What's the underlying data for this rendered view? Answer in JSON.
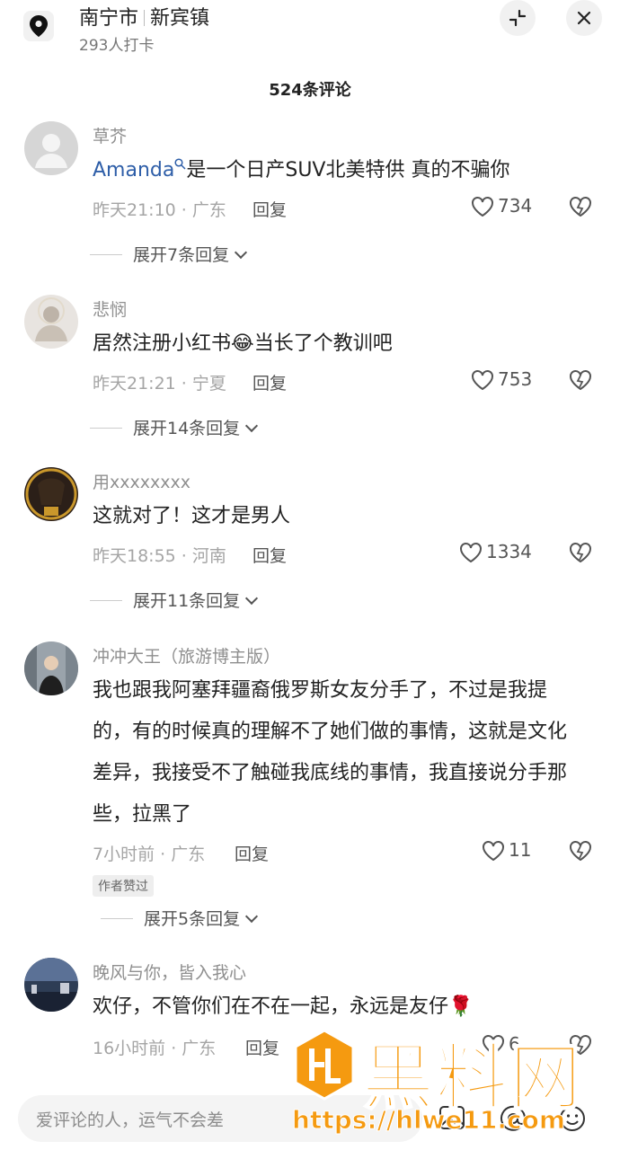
{
  "header": {
    "city": "南宁市",
    "town": "新宾镇",
    "checkins": "293人打卡",
    "comment_count": "524条评论"
  },
  "comments": [
    {
      "user": "草芥",
      "mention": "Amanda",
      "text": "是一个日产SUV北美特供 真的不骗你",
      "time_loc": "昨天21:10 · 广东",
      "reply": "回复",
      "likes": "734",
      "expand": "展开7条回复"
    },
    {
      "user": "悲悯",
      "text_a": "居然注册小红书",
      "emoji": "😂",
      "text_b": "当长了个教训吧",
      "time_loc": "昨天21:21 · 宁夏",
      "reply": "回复",
      "likes": "753",
      "expand": "展开14条回复"
    },
    {
      "user": "用xxxxxxxx",
      "text": "这就对了！这才是男人",
      "time_loc": "昨天18:55 · 河南",
      "reply": "回复",
      "likes": "1334",
      "expand": "展开11条回复"
    },
    {
      "user": "冲冲大王（旅游博主版）",
      "text": "我也跟我阿塞拜疆裔俄罗斯女友分手了，不过是我提的，有的时候真的理解不了她们做的事情，这就是文化差异，我接受不了触碰我底线的事情，我直接说分手那些，拉黑了",
      "time_loc": "7小时前 · 广东",
      "reply": "回复",
      "likes": "11",
      "badge": "作者赞过",
      "expand": "展开5条回复"
    },
    {
      "user": "晚风与你，皆入我心",
      "text": "欢仔，不管你们在不在一起，永远是友仔🌹",
      "time_loc": "16小时前 · 广东",
      "reply": "回复",
      "likes": "6"
    }
  ],
  "input": {
    "placeholder": "爱评论的人，运气不会差"
  },
  "watermark": {
    "title": "黑料网",
    "url": "https://hlwe11.com"
  },
  "colors": {
    "mention": "#2e5ea8",
    "watermark": "#f59a10"
  },
  "icons": [
    "location-pin-icon",
    "collapse-icon",
    "close-icon",
    "heart-icon",
    "dislike-heart-icon",
    "chevron-down-icon",
    "image-icon",
    "at-icon",
    "emoji-icon"
  ]
}
